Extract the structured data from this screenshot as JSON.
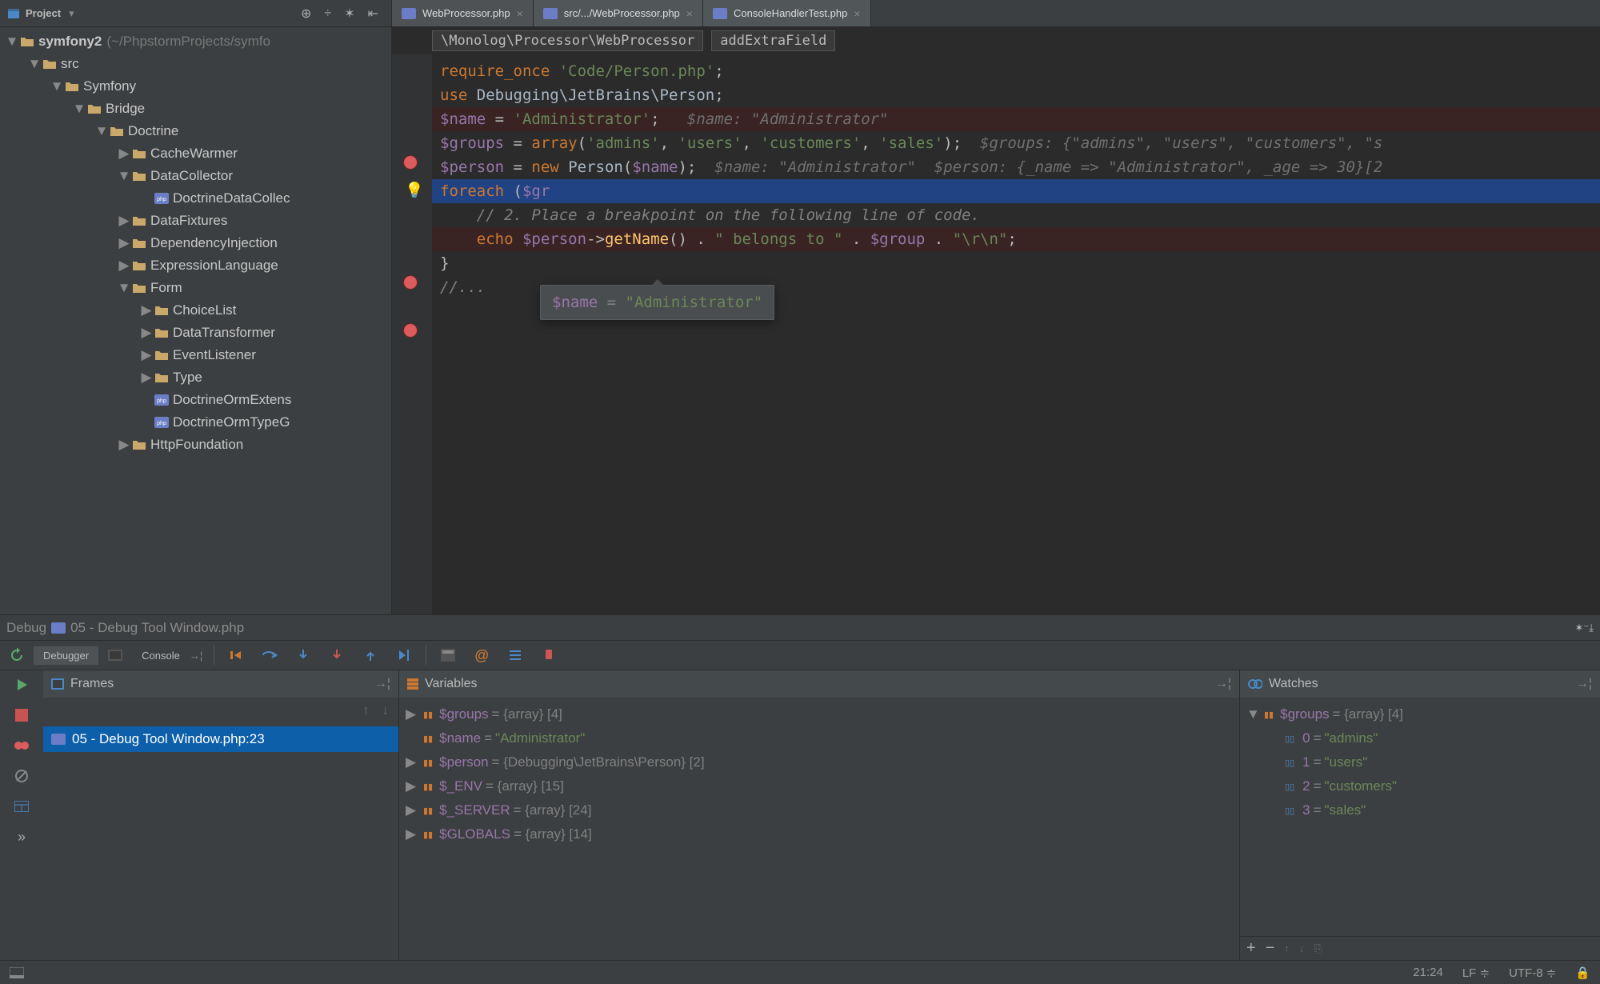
{
  "sidebar": {
    "title": "Project",
    "root": {
      "label": "symfony2",
      "path": "(~/PhpstormProjects/symfo"
    },
    "nodes": [
      {
        "indent": 1,
        "arrow": "▼",
        "icon": "folder",
        "label": "src"
      },
      {
        "indent": 2,
        "arrow": "▼",
        "icon": "folder",
        "label": "Symfony"
      },
      {
        "indent": 3,
        "arrow": "▼",
        "icon": "folder",
        "label": "Bridge"
      },
      {
        "indent": 4,
        "arrow": "▼",
        "icon": "folder",
        "label": "Doctrine"
      },
      {
        "indent": 5,
        "arrow": "▶",
        "icon": "folder",
        "label": "CacheWarmer"
      },
      {
        "indent": 5,
        "arrow": "▼",
        "icon": "folder",
        "label": "DataCollector"
      },
      {
        "indent": 6,
        "arrow": "",
        "icon": "php",
        "label": "DoctrineDataCollec"
      },
      {
        "indent": 5,
        "arrow": "▶",
        "icon": "folder",
        "label": "DataFixtures"
      },
      {
        "indent": 5,
        "arrow": "▶",
        "icon": "folder",
        "label": "DependencyInjection"
      },
      {
        "indent": 5,
        "arrow": "▶",
        "icon": "folder",
        "label": "ExpressionLanguage"
      },
      {
        "indent": 5,
        "arrow": "▼",
        "icon": "folder",
        "label": "Form"
      },
      {
        "indent": 6,
        "arrow": "▶",
        "icon": "folder",
        "label": "ChoiceList"
      },
      {
        "indent": 6,
        "arrow": "▶",
        "icon": "folder",
        "label": "DataTransformer"
      },
      {
        "indent": 6,
        "arrow": "▶",
        "icon": "folder",
        "label": "EventListener"
      },
      {
        "indent": 6,
        "arrow": "▶",
        "icon": "folder",
        "label": "Type"
      },
      {
        "indent": 6,
        "arrow": "",
        "icon": "php",
        "label": "DoctrineOrmExtens"
      },
      {
        "indent": 6,
        "arrow": "",
        "icon": "php",
        "label": "DoctrineOrmTypeG"
      },
      {
        "indent": 5,
        "arrow": "▶",
        "icon": "folder",
        "label": "HttpFoundation"
      }
    ]
  },
  "tabs": [
    {
      "icon": "php",
      "label": "WebProcessor.php",
      "active": true
    },
    {
      "icon": "php",
      "label": "src/.../WebProcessor.php",
      "active": false
    },
    {
      "icon": "php",
      "label": "ConsoleHandlerTest.php",
      "active": false
    }
  ],
  "breadcrumb": [
    "\\Monolog\\Processor\\WebProcessor",
    "addExtraField"
  ],
  "code": {
    "tooltip": {
      "var": "$name",
      "val": "\"Administrator\""
    }
  },
  "debugBar": {
    "label": "Debug",
    "file": "05 - Debug Tool Window.php"
  },
  "debugTabs": {
    "debugger": "Debugger",
    "console": "Console"
  },
  "frames": {
    "title": "Frames",
    "items": [
      {
        "label": "05 - Debug Tool Window.php:23",
        "selected": true
      }
    ]
  },
  "variables": {
    "title": "Variables",
    "items": [
      {
        "arrow": "▶",
        "name": "$groups",
        "rest": " = {array} [4]"
      },
      {
        "arrow": "",
        "name": "$name",
        "rest": " = ",
        "str": "\"Administrator\""
      },
      {
        "arrow": "▶",
        "name": "$person",
        "rest": " = {Debugging\\JetBrains\\Person} [2]"
      },
      {
        "arrow": "▶",
        "name": "$_ENV",
        "rest": " = {array} [15]"
      },
      {
        "arrow": "▶",
        "name": "$_SERVER",
        "rest": " = {array} [24]"
      },
      {
        "arrow": "▶",
        "name": "$GLOBALS",
        "rest": " = {array} [14]"
      }
    ]
  },
  "watches": {
    "title": "Watches",
    "root": {
      "arrow": "▼",
      "name": "$groups",
      "rest": " = {array} [4]"
    },
    "items": [
      {
        "key": "0",
        "val": "\"admins\""
      },
      {
        "key": "1",
        "val": "\"users\""
      },
      {
        "key": "2",
        "val": "\"customers\""
      },
      {
        "key": "3",
        "val": "\"sales\""
      }
    ]
  },
  "status": {
    "pos": "21:24",
    "le": "LF ≑",
    "enc": "UTF-8 ≑"
  }
}
